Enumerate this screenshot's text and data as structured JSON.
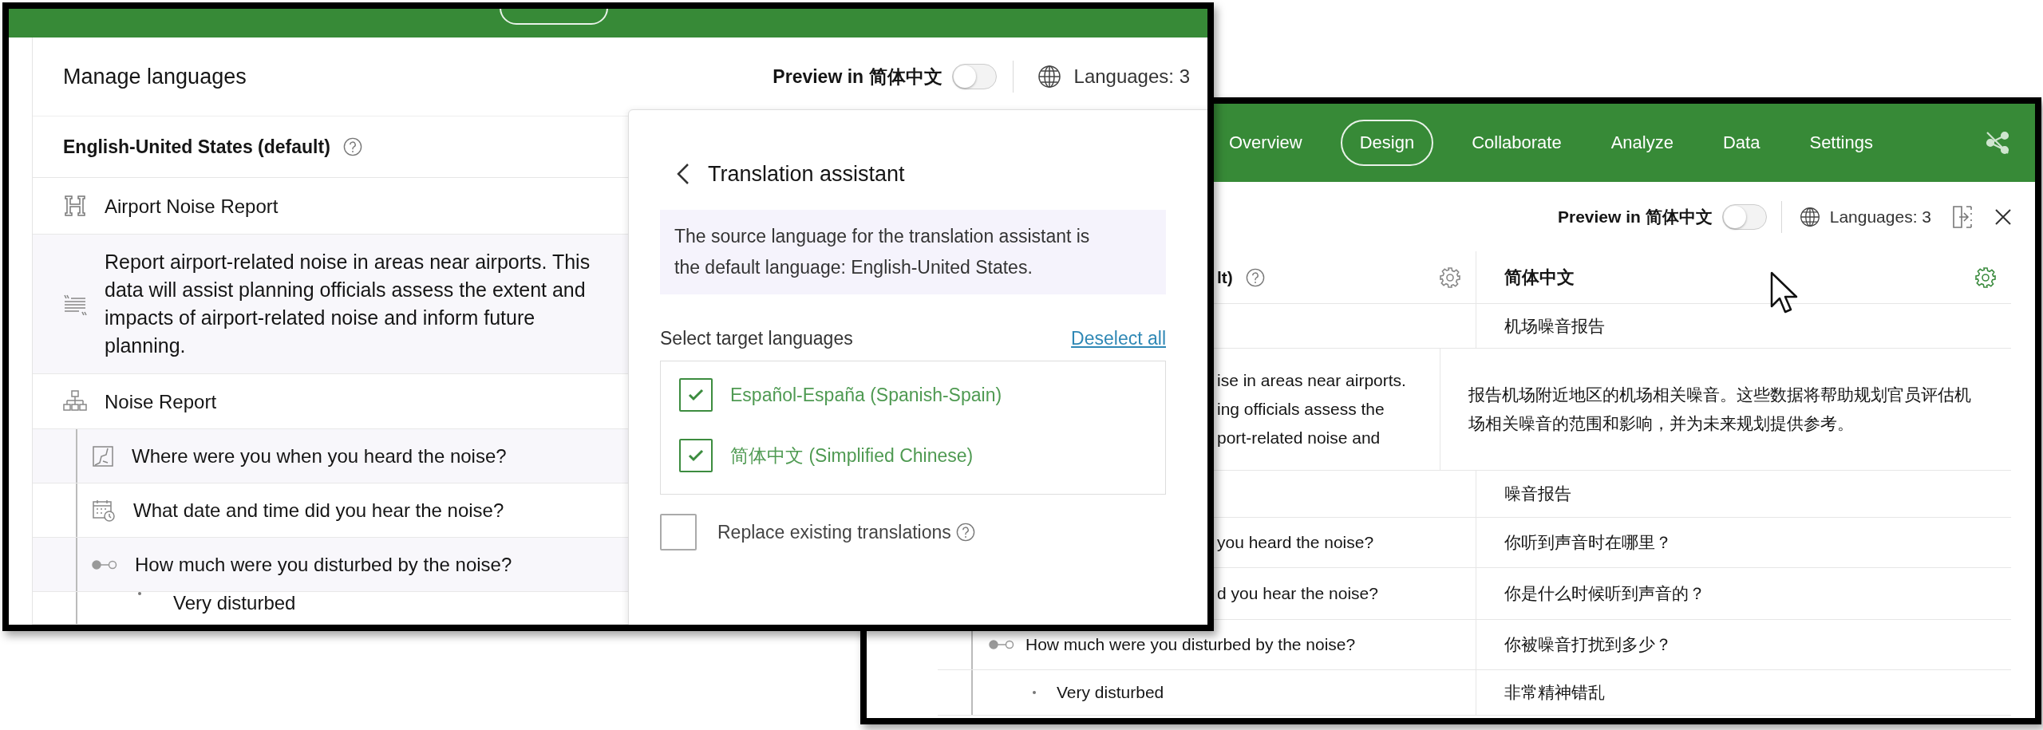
{
  "left_window": {
    "title": "Manage languages",
    "preview": {
      "label": "Preview in 简体中文",
      "on": false
    },
    "languages_count": "Languages: 3",
    "column_header": "English-United States (default)",
    "rows": [
      {
        "kind": "heading",
        "text": "Airport Noise Report"
      },
      {
        "kind": "description",
        "text": "Report airport-related noise in areas near airports. This data will assist planning officials assess the extent and impacts of airport-related noise and inform future planning."
      },
      {
        "kind": "group",
        "text": "Noise Report"
      },
      {
        "kind": "location",
        "text": "Where were you when you heard the noise?"
      },
      {
        "kind": "datetime",
        "text": "What date and time did you hear the noise?"
      },
      {
        "kind": "likert",
        "text": "How much were you disturbed by the noise?"
      },
      {
        "kind": "choice",
        "text": "Very disturbed"
      }
    ],
    "translation_panel": {
      "title": "Translation assistant",
      "note": "The source language for the translation assistant is the default language: English-United States.",
      "section_label": "Select target languages",
      "deselect_link": "Deselect all",
      "languages": [
        {
          "label": "Español-España (Spanish-Spain)",
          "checked": true
        },
        {
          "label": "简体中文 (Simplified Chinese)",
          "checked": true
        }
      ],
      "replace": {
        "label": "Replace existing translations",
        "checked": false
      }
    }
  },
  "right_window": {
    "nav_tabs": [
      {
        "label": "Overview",
        "selected": false
      },
      {
        "label": "Design",
        "selected": true
      },
      {
        "label": "Collaborate",
        "selected": false
      },
      {
        "label": "Analyze",
        "selected": false
      },
      {
        "label": "Data",
        "selected": false
      },
      {
        "label": "Settings",
        "selected": false
      }
    ],
    "preview": {
      "label": "Preview in 简体中文",
      "on": false
    },
    "languages_count": "Languages: 3",
    "columns": [
      "lt)",
      "简体中文"
    ],
    "rows": [
      {
        "kind": "heading",
        "target": "机场噪音报告"
      },
      {
        "kind": "description",
        "source_lines": [
          "ise in areas near airports.",
          "ing officials assess the",
          "port-related noise and"
        ],
        "target": "报告机场附近地区的机场相关噪音。这些数据将帮助规划官员评估机场相关噪音的范围和影响，并为未来规划提供参考。"
      },
      {
        "kind": "group",
        "target": "噪音报告"
      },
      {
        "kind": "location",
        "source": "you heard the noise?",
        "source_partial": true,
        "target": "你听到声音时在哪里？"
      },
      {
        "kind": "datetime",
        "source": "d you hear the noise?",
        "source_partial": true,
        "target": "你是什么时候听到声音的？"
      },
      {
        "kind": "likert",
        "source": "How much were you disturbed by the noise?",
        "source_partial": false,
        "target": "你被噪音打扰到多少？"
      },
      {
        "kind": "choice",
        "source": "Very disturbed",
        "source_partial": false,
        "target": "非常精神错乱"
      }
    ]
  }
}
